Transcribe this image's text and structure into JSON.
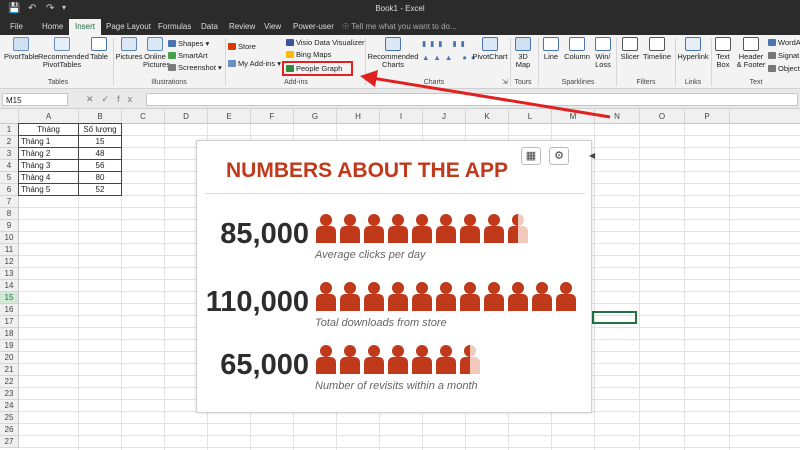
{
  "window": {
    "title": "Book1 - Excel"
  },
  "menu": {
    "tabs": [
      "File",
      "Home",
      "Insert",
      "Page Layout",
      "Formulas",
      "Data",
      "Review",
      "View",
      "Power-user"
    ],
    "active": "Insert",
    "tell_me": "Tell me what you want to do..."
  },
  "ribbon": {
    "pivottable": "PivotTable",
    "recommended_pivot": [
      "Recommended",
      "PivotTables"
    ],
    "table": "Table",
    "pictures": "Pictures",
    "online_pictures": [
      "Online",
      "Pictures"
    ],
    "shapes": "Shapes",
    "smartart": "SmartArt",
    "screenshot": "Screenshot",
    "store": "Store",
    "my_addins": "My Add-ins",
    "visio": "Visio Data Visualizer",
    "bing": "Bing Maps",
    "people_graph": "People Graph",
    "recommended_charts": [
      "Recommended",
      "Charts"
    ],
    "pivotchart": "PivotChart",
    "map3d": [
      "3D",
      "Map"
    ],
    "line": "Line",
    "column": "Column",
    "winloss": [
      "Win/",
      "Loss"
    ],
    "slicer": "Slicer",
    "timeline": "Timeline",
    "hyperlink": "Hyperlink",
    "textbox": [
      "Text",
      "Box"
    ],
    "header_footer": [
      "Header",
      "& Footer"
    ],
    "wordart": "WordArt",
    "signature": "Signat",
    "object": "Object",
    "groups": {
      "tables": "Tables",
      "illustrations": "Illustrations",
      "addins": "Add-ins",
      "charts": "Charts",
      "tours": "Tours",
      "sparklines": "Sparklines",
      "filters": "Filters",
      "links": "Links",
      "text": "Text"
    }
  },
  "formula_bar": {
    "name_box": "M15",
    "value": ""
  },
  "sheet": {
    "columns": [
      "A",
      "B",
      "C",
      "D",
      "E",
      "F",
      "G",
      "H",
      "I",
      "J",
      "K",
      "L",
      "M",
      "N",
      "O",
      "P"
    ],
    "rows": [
      "1",
      "2",
      "3",
      "4",
      "5",
      "6",
      "7",
      "8",
      "9",
      "10",
      "11",
      "12",
      "13",
      "14",
      "15",
      "16",
      "17",
      "18",
      "19",
      "20",
      "21",
      "22",
      "23",
      "24",
      "25",
      "26",
      "27"
    ],
    "selected_row": "15",
    "table": {
      "headers": [
        "Tháng",
        "Số lượng"
      ],
      "rows": [
        [
          "Tháng 1",
          "15"
        ],
        [
          "Tháng 2",
          "48"
        ],
        [
          "Tháng 3",
          "56"
        ],
        [
          "Tháng 4",
          "80"
        ],
        [
          "Tháng 5",
          "52"
        ]
      ]
    }
  },
  "people_graph": {
    "title": "NUMBERS ABOUT THE APP",
    "icon_color": "#c0391b",
    "stats": [
      {
        "value": "85,000",
        "label": "Average clicks per day",
        "icons": 8.5
      },
      {
        "value": "110,000",
        "label": "Total downloads from store",
        "icons": 11
      },
      {
        "value": "65,000",
        "label": "Number of revisits within a month",
        "icons": 6.5
      }
    ]
  },
  "colors": {
    "excel_green": "#217346",
    "accent_red": "#e12020",
    "title_red": "#c0391b"
  }
}
